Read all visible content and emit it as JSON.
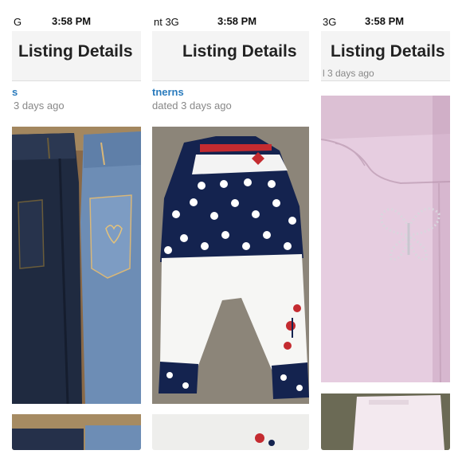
{
  "panels": [
    {
      "status": {
        "carrier": "G",
        "time": "3:58 PM"
      },
      "nav_title": "Listing Details",
      "seller_fragment": "s",
      "updated_text": "3 days ago",
      "photo_subject": "two pairs of denim jeans"
    },
    {
      "status": {
        "carrier": "nt  3G",
        "time": "3:58 PM"
      },
      "nav_title": "Listing Details",
      "seller_fragment": "tnerns",
      "updated_text": "dated 3 days ago",
      "photo_subject": "navy polka-dot top with white capri pants"
    },
    {
      "status": {
        "carrier": "3G",
        "time": "3:58 PM"
      },
      "nav_title": "Listing Details",
      "updated_text": "l 3 days ago",
      "photo_subject": "pink pants with rhinestone butterfly"
    }
  ]
}
